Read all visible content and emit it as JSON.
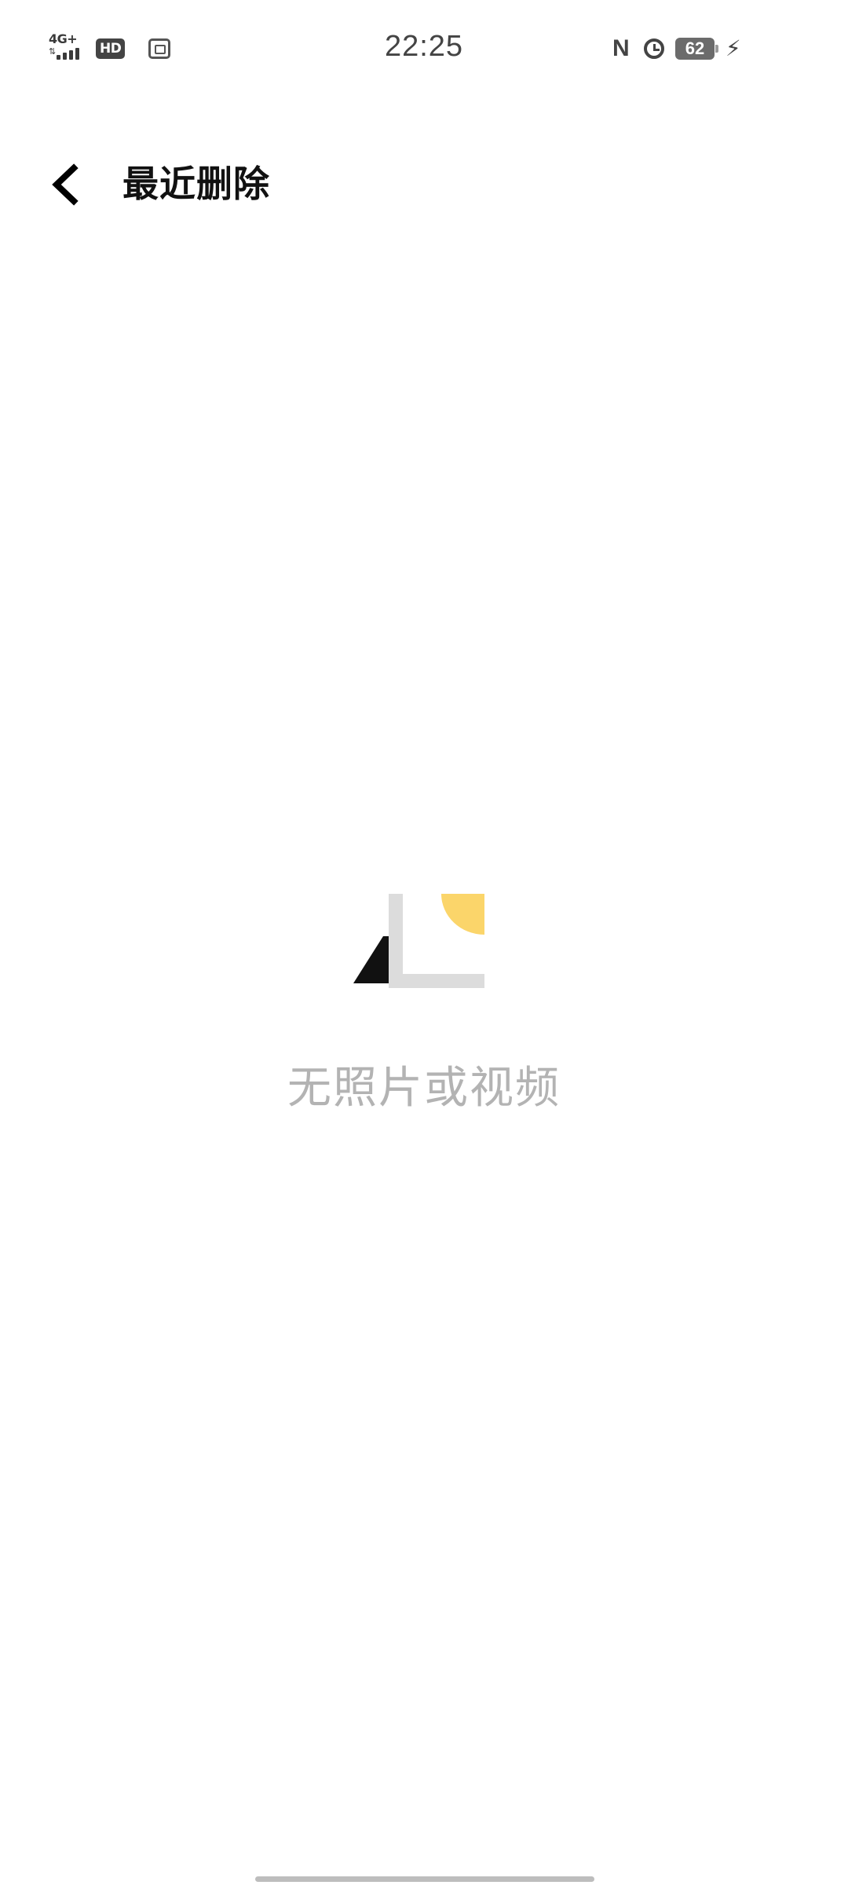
{
  "status_bar": {
    "network_label": "4G+",
    "network_arrows": "⇅",
    "hd_label": "HD",
    "time": "22:25",
    "nfc_label": "N",
    "battery_level": "62",
    "charging_icon": "bolt-icon"
  },
  "app_bar": {
    "back_icon": "chevron-left-icon",
    "title": "最近删除"
  },
  "empty_state": {
    "illustration": "empty-photo-illustration",
    "message": "无照片或视频",
    "colors": {
      "frame": "#dcdcdc",
      "sun": "#fbd56a",
      "mountain": "#111111",
      "text": "#b3b3b3"
    }
  }
}
